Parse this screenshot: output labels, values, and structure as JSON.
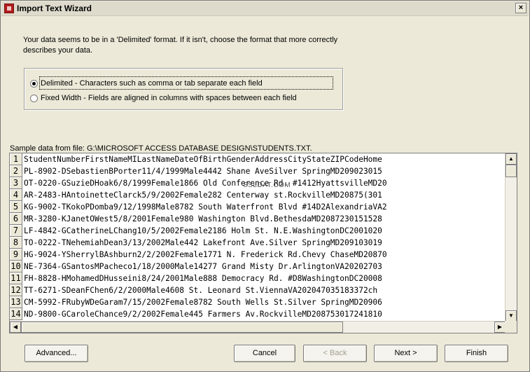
{
  "window": {
    "title": "Import Text Wizard",
    "close_glyph": "×"
  },
  "intro_text": "Your data seems to be in a 'Delimited' format. If it isn't, choose the format that more correctly describes your data.",
  "format_options": [
    {
      "label": "Delimited - Characters such as comma or tab separate each field",
      "selected": true
    },
    {
      "label": "Fixed Width - Fields are aligned in columns with spaces between each field",
      "selected": false
    }
  ],
  "sample_label": "Sample data from file: G:\\MICROSOFT ACCESS DATABASE DESIGN\\STUDENTS.TXT.",
  "watermark": "SSLDAT.COM",
  "sample_rows": [
    {
      "num": "1",
      "text": "StudentNumberFirstNameMILastNameDateOfBirthGenderAddressCityStateZIPCodeHome"
    },
    {
      "num": "2",
      "text": "PL-8902-DSebastienBPorter11/4/1999Male4442 Shane AveSilver SpringMD209023015"
    },
    {
      "num": "3",
      "text": "OT-0220-GSuzieDHoak6/8/1999Female1866 Old Conference Rd. #1412HyattsvilleMD20"
    },
    {
      "num": "4",
      "text": "AR-2483-HAntoinetteClarck5/9/2002Female282 Centerway st.RockvilleMD20875(301"
    },
    {
      "num": "5",
      "text": "KG-9002-TKokoPDomba9/12/1998Male8782 South Waterfront Blvd #14D2AlexandriaVA2"
    },
    {
      "num": "6",
      "text": "MR-3280-KJanetOWest5/8/2001Female980 Washington Blvd.BethesdaMD2087230151528"
    },
    {
      "num": "7",
      "text": "LF-4842-GCatherineLChang10/5/2002Female2186 Holm St. N.E.WashingtonDC2001020"
    },
    {
      "num": "8",
      "text": "TO-0222-TNehemiahDean3/13/2002Male442 Lakefront Ave.Silver SpringMD209103019"
    },
    {
      "num": "9",
      "text": "HG-9024-YSherrylBAshburn2/2/2002Female1771 N. Frederick Rd.Chevy ChaseMD20870"
    },
    {
      "num": "10",
      "text": "NE-7364-GSantosMPacheco1/18/2000Male14277 Grand Misty Dr.ArlingtonVA20202703"
    },
    {
      "num": "11",
      "text": "FH-8828-HMohamedDHusseini8/24/2001Male888 Democracy Rd. #D8WashingtonDC20008"
    },
    {
      "num": "12",
      "text": "TT-6271-SDeanFChen6/2/2000Male4608 St. Leonard St.ViennaVA202047035183372ch"
    },
    {
      "num": "13",
      "text": "CM-5992-FRubyWDeGaram7/15/2002Female8782 South Wells St.Silver SpringMD20906"
    },
    {
      "num": "14",
      "text": "ND-9800-GCaroleChance9/2/2002Female445 Farmers Av.RockvilleMD208753017241810"
    }
  ],
  "scrollbar_glyphs": {
    "up": "▲",
    "down": "▼",
    "left": "◀",
    "right": "▶"
  },
  "buttons": {
    "advanced": "Advanced...",
    "cancel": "Cancel",
    "back": "< Back",
    "next": "Next >",
    "finish": "Finish"
  }
}
